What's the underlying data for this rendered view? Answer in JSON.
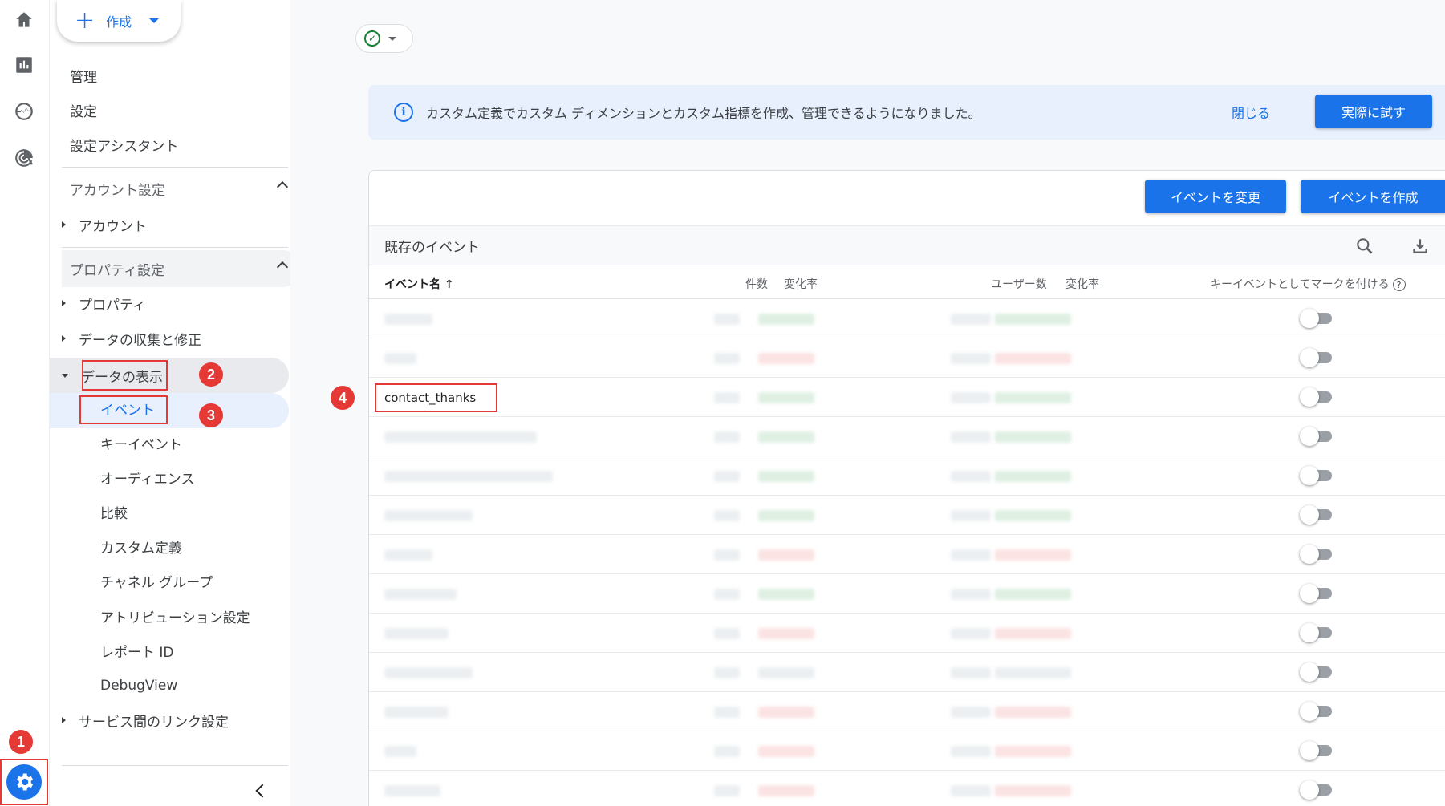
{
  "create": {
    "label": "作成"
  },
  "nav": {
    "top_items": [
      "管理",
      "設定",
      "設定アシスタント"
    ],
    "account_section": {
      "title": "アカウント設定",
      "items": [
        "アカウント"
      ]
    },
    "property_section": {
      "title": "プロパティ設定",
      "items": [
        "プロパティ",
        "データの収集と修正",
        "データの表示"
      ],
      "display_subitems": [
        "イベント",
        "キーイベント",
        "オーディエンス",
        "比較",
        "カスタム定義",
        "チャネル グループ",
        "アトリビューション設定",
        "レポート ID",
        "DebugView"
      ],
      "link_settings": "サービス間のリンク設定"
    }
  },
  "badges": [
    "1",
    "2",
    "3",
    "4"
  ],
  "banner": {
    "text": "カスタム定義でカスタム ディメンションとカスタム指標を作成、管理できるようになりました。",
    "close": "閉じる",
    "try": "実際に試す"
  },
  "card": {
    "modify_button": "イベントを変更",
    "create_button": "イベントを作成",
    "subtitle": "既存のイベント",
    "columns": {
      "event_name": "イベント名 ↑",
      "count": "件数",
      "count_change": "変化率",
      "users": "ユーザー数",
      "users_change": "変化率",
      "mark_key_event": "キーイベントとしてマークを付ける"
    },
    "highlighted_event": "contact_thanks"
  },
  "colors": {
    "accent": "#1a73e8",
    "highlight": "#e53935"
  }
}
